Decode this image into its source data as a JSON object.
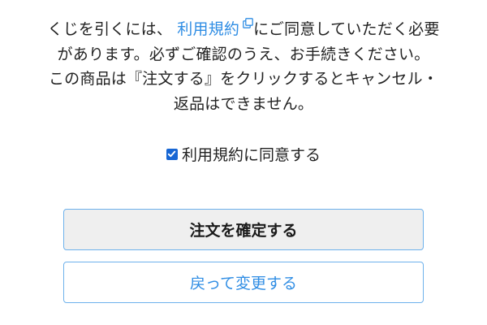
{
  "notice": {
    "line1_prefix": "くじを引くには、",
    "terms_link_label": "利用規約",
    "line1_suffix": "にご同意していただく必要があります。必ずご確認のうえ、お手続きください。",
    "cancel_notice": "この商品は『注文する』をクリックするとキャンセル・返品はできません。"
  },
  "agree": {
    "checked": true,
    "label": "利用規約に同意する"
  },
  "buttons": {
    "confirm_label": "注文を確定する",
    "back_label": "戻って変更する"
  },
  "colors": {
    "link": "#2f8de4",
    "checkbox": "#1766d4",
    "button_border": "#6db1ec",
    "confirm_bg": "#efefef"
  },
  "icons": {
    "terms_link": "external-link-icon",
    "checkbox": "check-icon"
  }
}
